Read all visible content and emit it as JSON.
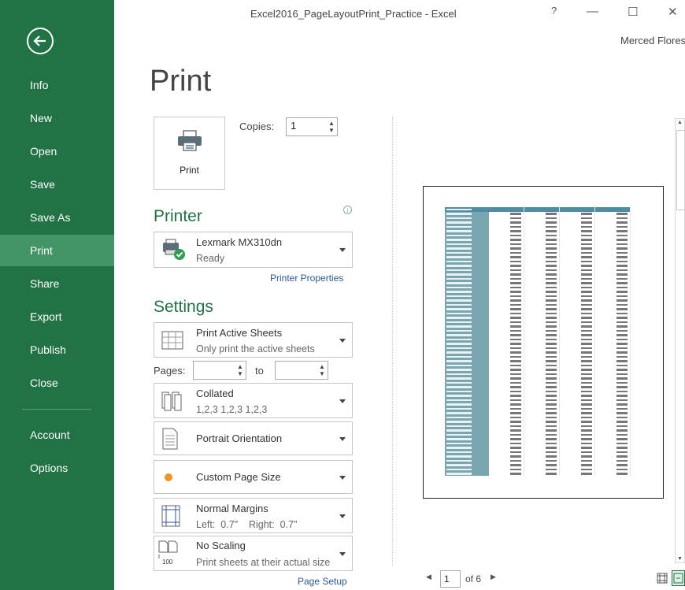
{
  "window": {
    "title": "Excel2016_PageLayoutPrint_Practice - Excel",
    "help_glyph": "?",
    "minimize_glyph": "—",
    "restore_glyph": "☐",
    "close_glyph": "✕",
    "user": "Merced Flores"
  },
  "sidebar": {
    "accent_color": "#217346",
    "active_color": "#439467",
    "items": [
      {
        "label": "Info"
      },
      {
        "label": "New"
      },
      {
        "label": "Open"
      },
      {
        "label": "Save"
      },
      {
        "label": "Save As"
      },
      {
        "label": "Print",
        "active": true
      },
      {
        "label": "Share"
      },
      {
        "label": "Export"
      },
      {
        "label": "Publish"
      },
      {
        "label": "Close"
      },
      {
        "label": "Account"
      },
      {
        "label": "Options"
      }
    ]
  },
  "main": {
    "heading": "Print",
    "print_button_label": "Print",
    "copies_label": "Copies:",
    "copies_value": "1",
    "printer": {
      "section_title": "Printer",
      "name": "Lexmark MX310dn",
      "status": "Ready",
      "properties_link": "Printer Properties"
    },
    "settings": {
      "section_title": "Settings",
      "print_what": {
        "title": "Print Active Sheets",
        "subtitle": "Only print the active sheets"
      },
      "pages_label": "Pages:",
      "to_label": "to",
      "collation": {
        "title": "Collated",
        "subtitle": "1,2,3    1,2,3    1,2,3"
      },
      "orientation": {
        "title": "Portrait Orientation"
      },
      "page_size": {
        "title": "Custom Page Size"
      },
      "margins": {
        "title": "Normal Margins",
        "subtitle": "Left:  0.7\"    Right:  0.7\""
      },
      "scaling": {
        "title": "No Scaling",
        "subtitle": "Print sheets at their actual size",
        "icon_text": "100"
      },
      "page_setup_link": "Page Setup"
    }
  },
  "preview": {
    "current_page": "1",
    "page_total": "of 6"
  }
}
